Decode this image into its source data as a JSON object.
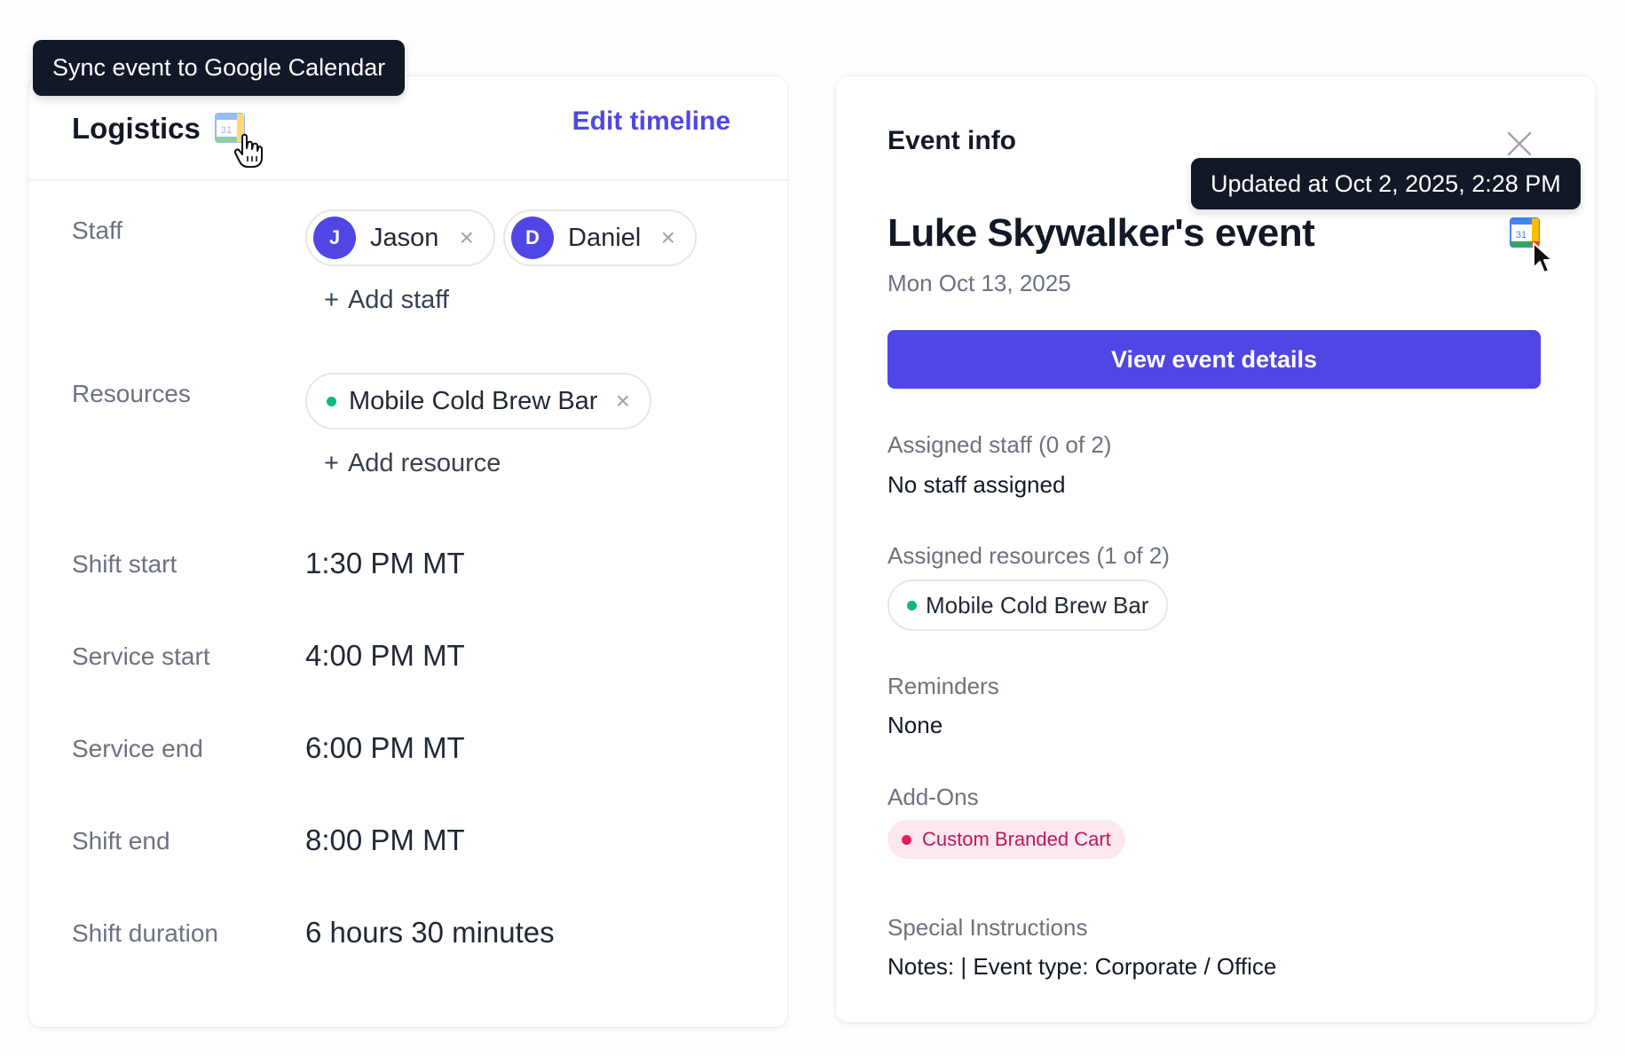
{
  "tooltip_sync": "Sync event to Google Calendar",
  "logistics": {
    "title": "Logistics",
    "edit_timeline": "Edit timeline",
    "staff": {
      "label": "Staff",
      "members": [
        {
          "initial": "J",
          "name": "Jason",
          "remove": "×"
        },
        {
          "initial": "D",
          "name": "Daniel",
          "remove": "×"
        }
      ],
      "add_plus": "+",
      "add_label": "Add staff"
    },
    "resources": {
      "label": "Resources",
      "items": [
        {
          "name": "Mobile Cold Brew Bar",
          "remove": "×"
        }
      ],
      "add_plus": "+",
      "add_label": "Add resource"
    },
    "times": [
      {
        "label": "Shift start",
        "value": "1:30 PM MT"
      },
      {
        "label": "Service start",
        "value": "4:00 PM MT"
      },
      {
        "label": "Service end",
        "value": "6:00 PM MT"
      },
      {
        "label": "Shift end",
        "value": "8:00 PM MT"
      },
      {
        "label": "Shift duration",
        "value": "6 hours 30 minutes"
      }
    ]
  },
  "event_info": {
    "title": "Event info",
    "tooltip_updated": "Updated at Oct 2, 2025, 2:28 PM",
    "event_name": "Luke Skywalker's event",
    "event_date": "Mon Oct 13, 2025",
    "view_button": "View event details",
    "assigned_staff_label": "Assigned staff (0 of 2)",
    "assigned_staff_value": "No staff assigned",
    "assigned_resources_label": "Assigned resources (1 of 2)",
    "assigned_resource": "Mobile Cold Brew Bar",
    "reminders_label": "Reminders",
    "reminders_value": "None",
    "addons_label": "Add-Ons",
    "addon": "Custom Branded Cart",
    "special_label": "Special Instructions",
    "special_value": "Notes:  | Event type: Corporate / Office"
  },
  "gcal_day": "31",
  "colors": {
    "accent": "#4f46e5",
    "resource_dot": "#10b981",
    "addon_bg": "#fde8ef",
    "addon_text": "#be185d",
    "tooltip_bg": "#111827"
  },
  "icons": [
    "google-calendar-icon",
    "hand-cursor-icon",
    "close-icon",
    "arrow-cursor-icon",
    "remove-x-icon",
    "status-dot-icon"
  ]
}
